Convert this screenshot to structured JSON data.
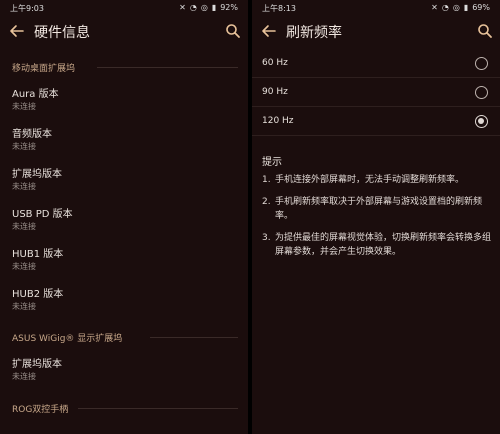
{
  "left": {
    "status": {
      "time": "上午9:03",
      "battery": "92%"
    },
    "title": "硬件信息",
    "sections": [
      {
        "label": "移动桌面扩展坞"
      },
      {
        "label": "ASUS WiGig® 显示扩展坞"
      },
      {
        "label": "ROG双控手柄"
      }
    ],
    "items": [
      {
        "title": "Aura 版本",
        "status": "未连接"
      },
      {
        "title": "音频版本",
        "status": "未连接"
      },
      {
        "title": "扩展坞版本",
        "status": "未连接"
      },
      {
        "title": "USB PD 版本",
        "status": "未连接"
      },
      {
        "title": "HUB1 版本",
        "status": "未连接"
      },
      {
        "title": "HUB2 版本",
        "status": "未连接"
      },
      {
        "title": "扩展坞版本",
        "status": "未连接"
      }
    ]
  },
  "right": {
    "status": {
      "time": "上午8:13",
      "battery": "69%"
    },
    "title": "刷新频率",
    "options": [
      {
        "label": "60 Hz",
        "selected": false
      },
      {
        "label": "90 Hz",
        "selected": false
      },
      {
        "label": "120 Hz",
        "selected": true
      }
    ],
    "tips_title": "提示",
    "tips": [
      {
        "n": "1.",
        "text": "手机连接外部屏幕时，无法手动调整刷新频率。"
      },
      {
        "n": "2.",
        "text": "手机刷新频率取决于外部屏幕与游戏设置档的刷新频率。"
      },
      {
        "n": "3.",
        "text": "为提供最佳的屏幕视觉体验，切换刷新频率会转换多组屏幕参数，并会产生切换效果。"
      }
    ]
  },
  "colors": {
    "background": "#1b0d0d",
    "section": "#c8a88a",
    "divider": "#2e1f1e"
  },
  "icons": [
    "back-arrow-icon",
    "search-icon",
    "radio-button-icon",
    "wifi-icon",
    "battery-icon",
    "alarm-icon",
    "mute-icon"
  ]
}
